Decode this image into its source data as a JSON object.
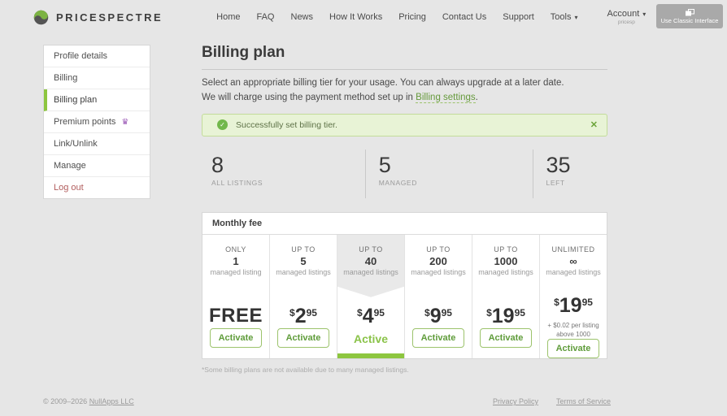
{
  "brand": {
    "name": "PRICESPECTRE"
  },
  "header": {
    "nav": [
      {
        "label": "Home"
      },
      {
        "label": "FAQ"
      },
      {
        "label": "News"
      },
      {
        "label": "How It Works"
      },
      {
        "label": "Pricing"
      },
      {
        "label": "Contact Us"
      },
      {
        "label": "Support"
      }
    ],
    "tools": {
      "label": "Tools",
      "caret": "▾"
    },
    "account": {
      "label": "Account",
      "caret": "▾",
      "username": "pricesp"
    },
    "classic_button": {
      "label": "Use Classic Interface"
    }
  },
  "sidebar": {
    "items": [
      {
        "label": "Profile details"
      },
      {
        "label": "Billing"
      },
      {
        "label": "Billing plan"
      },
      {
        "label": "Premium points"
      },
      {
        "label": "Link/Unlink"
      },
      {
        "label": "Manage"
      },
      {
        "label": "Log out"
      }
    ],
    "active_item": "Billing plan",
    "premium_icon": "♛"
  },
  "main": {
    "title": "Billing plan",
    "description_line1": "Select an appropriate billing tier for your usage. You can always upgrade at a later date.",
    "description_line2_prefix": "We will charge using the payment method set up in ",
    "description_link": "Billing settings",
    "description_suffix": ".",
    "alert": {
      "message": "Successfully set billing tier.",
      "close": "✕",
      "check": "✓"
    },
    "stats": [
      {
        "value": "8",
        "label": "ALL LISTINGS"
      },
      {
        "value": "5",
        "label": "MANAGED"
      },
      {
        "value": "35",
        "label": "LEFT"
      }
    ],
    "pricing": {
      "header": "Monthly fee",
      "tiers": [
        {
          "qualifier": "ONLY",
          "quantity": "1",
          "unit": "managed listing",
          "price": "FREE",
          "button_label": "Activate"
        },
        {
          "qualifier": "UP TO",
          "quantity": "5",
          "unit": "managed listings",
          "currency": "$",
          "amount": "2",
          "cents": "95",
          "button_label": "Activate"
        },
        {
          "qualifier": "UP TO",
          "quantity": "40",
          "unit": "managed listings",
          "currency": "$",
          "amount": "4",
          "cents": "95",
          "status_label": "Active",
          "active": true
        },
        {
          "qualifier": "UP TO",
          "quantity": "200",
          "unit": "managed listings",
          "currency": "$",
          "amount": "9",
          "cents": "95",
          "button_label": "Activate"
        },
        {
          "qualifier": "UP TO",
          "quantity": "1000",
          "unit": "managed listings",
          "currency": "$",
          "amount": "19",
          "cents": "95",
          "button_label": "Activate"
        },
        {
          "qualifier": "UNLIMITED",
          "quantity": "∞",
          "unit": "managed listings",
          "currency": "$",
          "amount": "19",
          "cents": "95",
          "note_line1": "+ $0.02 per listing",
          "note_line2": "above 1000",
          "button_label": "Activate"
        }
      ],
      "footnote": "*Some billing plans are not available due to many managed listings."
    }
  },
  "footer": {
    "copyright_prefix": "© 2009–2026 ",
    "company_link": "NullApps LLC",
    "privacy": "Privacy Policy",
    "terms": "Terms of Service"
  },
  "colors": {
    "accent_green": "#8dc63f",
    "button_green_text": "#5f9c3a",
    "alert_bg": "#e8f3d6",
    "crown_purple": "#9b59b6",
    "logout_red": "#b15d5d",
    "page_bg": "#e6e6e6"
  }
}
